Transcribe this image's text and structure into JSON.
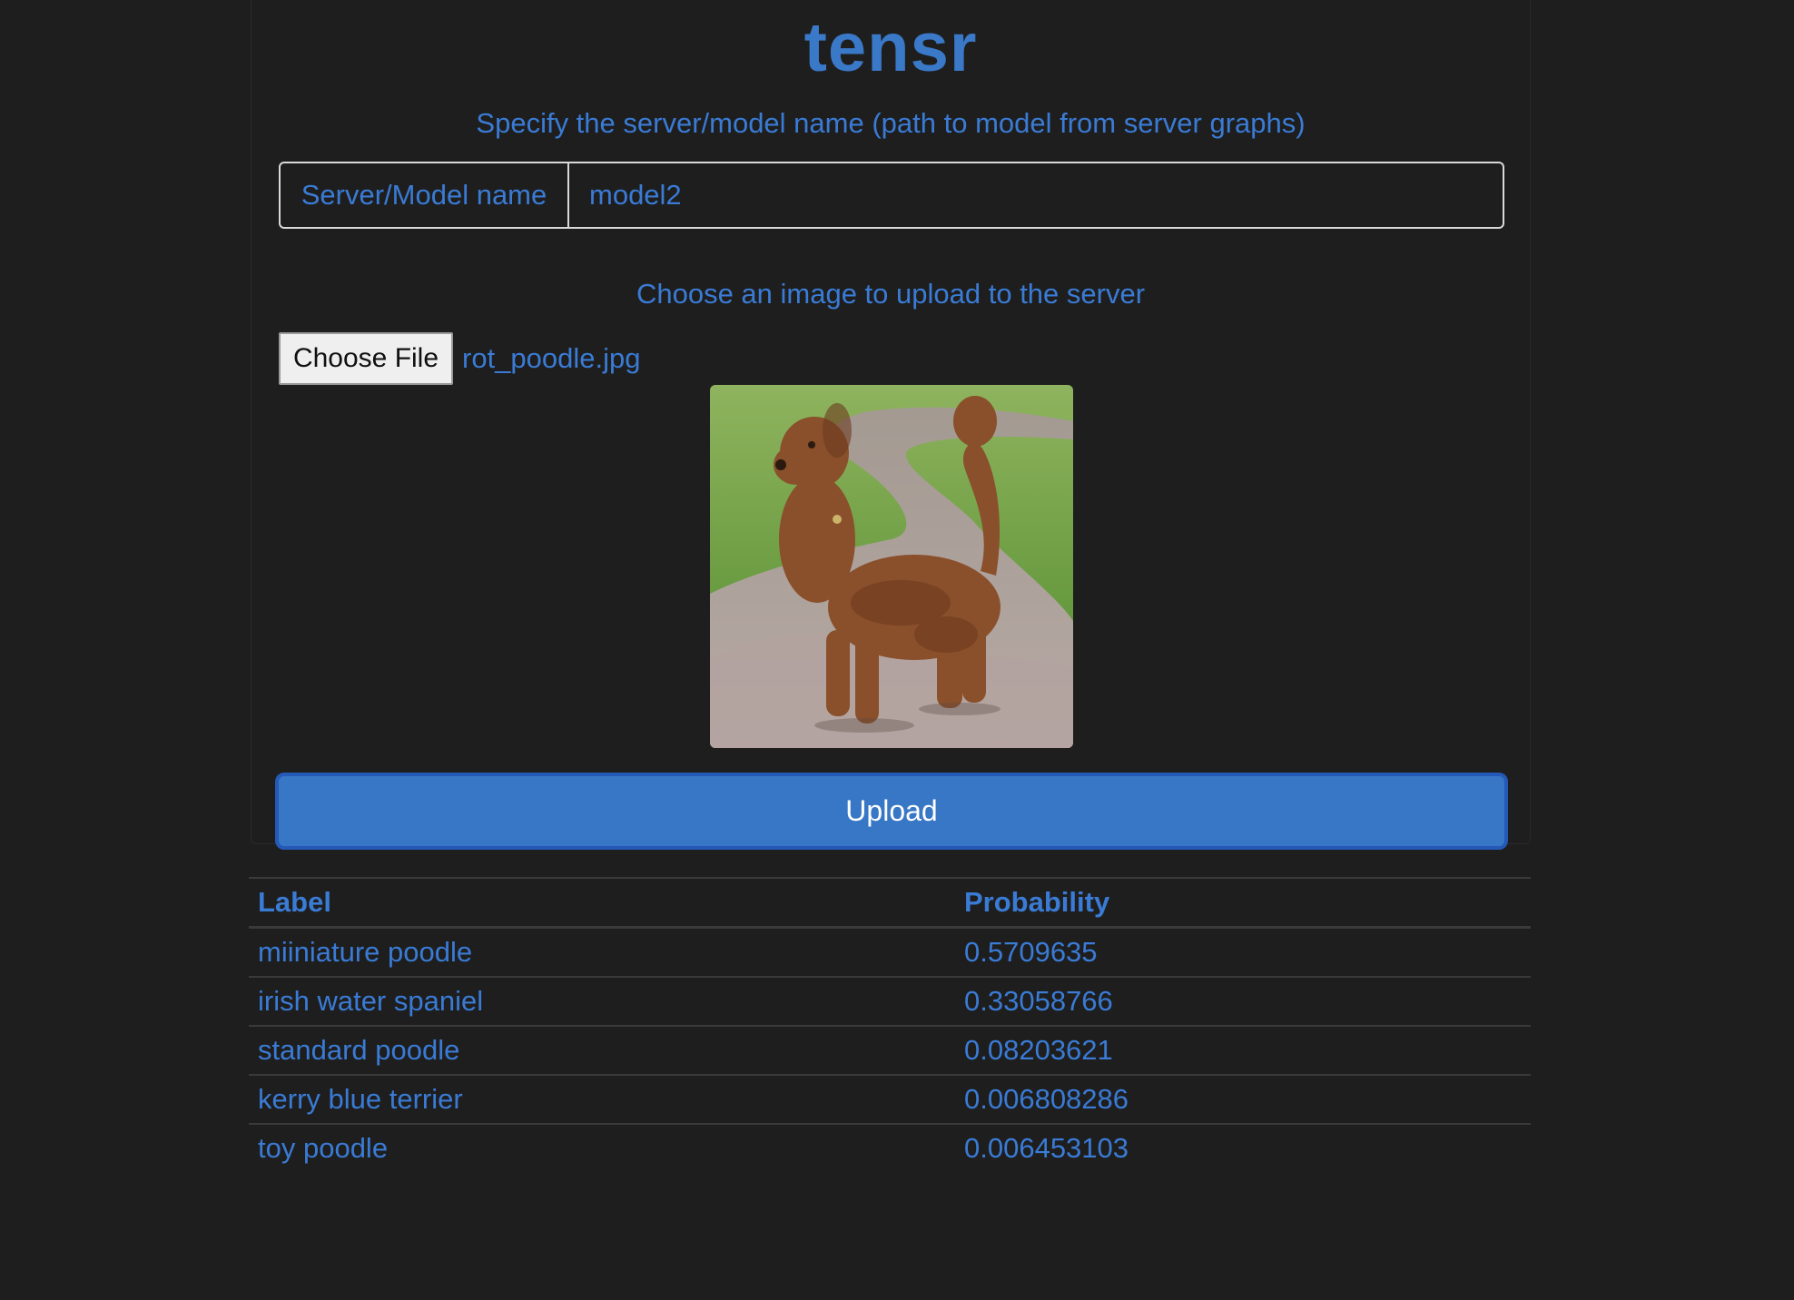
{
  "app": {
    "title": "tensr"
  },
  "model_section": {
    "instruction": "Specify the server/model name (path to model from server graphs)",
    "prefix_label": "Server/Model name",
    "input_value": "model2"
  },
  "upload_section": {
    "instruction": "Choose an image to upload to the server",
    "choose_button_label": "Choose File",
    "file_name": "rot_poodle.jpg",
    "upload_button_label": "Upload"
  },
  "results": {
    "headers": [
      "Label",
      "Probability"
    ],
    "rows": [
      {
        "label": "miiniature poodle",
        "probability": "0.5709635"
      },
      {
        "label": "irish water spaniel",
        "probability": "0.33058766"
      },
      {
        "label": "standard poodle",
        "probability": "0.08203621"
      },
      {
        "label": "kerry blue terrier",
        "probability": "0.006808286"
      },
      {
        "label": "toy poodle",
        "probability": "0.006453103"
      }
    ]
  },
  "colors": {
    "background": "#1e1e1e",
    "accent": "#3a7bd5",
    "button": "#3777c5"
  }
}
